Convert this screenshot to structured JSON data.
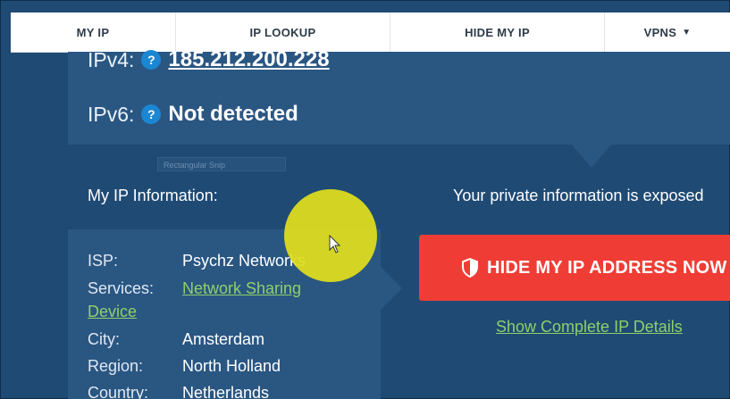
{
  "nav": {
    "items": [
      {
        "label": "MY IP"
      },
      {
        "label": "IP LOOKUP"
      },
      {
        "label": "HIDE MY IP"
      },
      {
        "label": "VPNS"
      }
    ],
    "caret": "▼"
  },
  "ip": {
    "ipv4_label": "IPv4:",
    "ipv4_value": "185.212.200.228",
    "ipv6_label": "IPv6:",
    "ipv6_value": "Not detected",
    "help": "?"
  },
  "snip": "Rectangular Snip",
  "sections": {
    "left_heading": "My IP Information:",
    "right_heading": "Your private information is exposed"
  },
  "info": {
    "rows": [
      {
        "label": "ISP:",
        "value": "Psychz Networks"
      },
      {
        "label": "Services:",
        "value": "Network Sharing",
        "value_cont": "Device"
      },
      {
        "label": "City:",
        "value": "Amsterdam"
      },
      {
        "label": "Region:",
        "value": "North Holland"
      },
      {
        "label": "Country:",
        "value": "Netherlands"
      }
    ]
  },
  "cta": {
    "label": "HIDE MY IP ADDRESS NOW"
  },
  "details_link": "Show Complete IP Details",
  "colors": {
    "background": "#1f4a74",
    "panel": "#2a5682",
    "accent_red": "#ef3d35",
    "link_green": "#8fd06a",
    "help_blue": "#1b86d1",
    "highlight": "#e2de1c"
  }
}
